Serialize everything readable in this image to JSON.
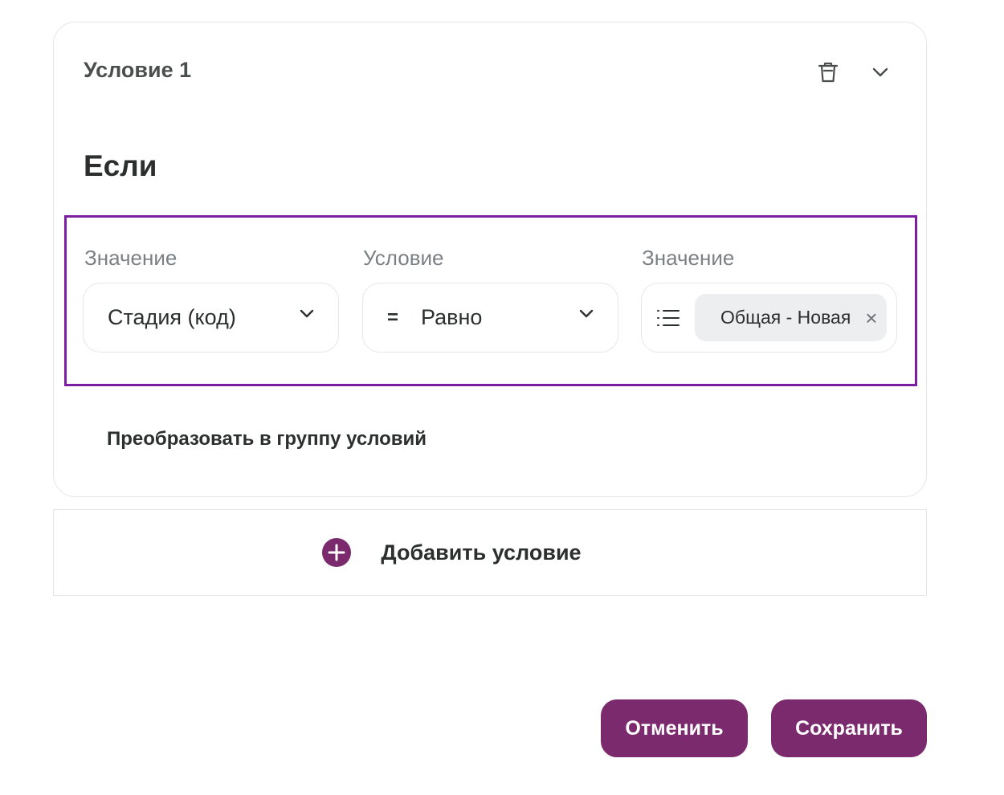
{
  "condition_card": {
    "title": "Условие 1",
    "if_label": "Если",
    "icons": {
      "delete": "trash-icon",
      "collapse": "chevron-down-icon"
    },
    "fields": {
      "field1": {
        "label": "Значение",
        "value": "Стадия (код)"
      },
      "field2": {
        "label": "Условие",
        "operator_symbol": "=",
        "value": "Равно"
      },
      "field3": {
        "label": "Значение",
        "tag": "Общая - Новая",
        "tag_close": "×"
      }
    },
    "convert_link": "Преобразовать в группу условий"
  },
  "add_condition": {
    "label": "Добавить условие",
    "icon": "plus-circle-icon"
  },
  "footer": {
    "cancel_label": "Отменить",
    "save_label": "Сохранить"
  },
  "colors": {
    "accent": "#7b2a6e",
    "highlight_border": "#7a1fa2",
    "muted_text": "#7b8085"
  }
}
